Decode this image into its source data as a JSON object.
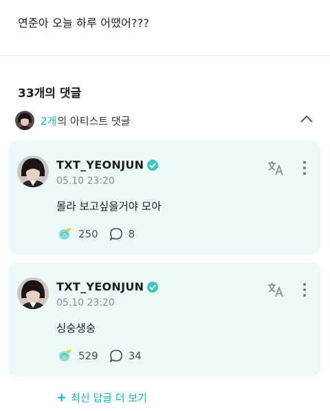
{
  "post": {
    "text": "연준아 오늘 하루 어땠어???"
  },
  "comments_section": {
    "title": "33개의 댓글",
    "artist_toggle": {
      "count": "2개",
      "label": "의 아티스트 댓글",
      "chevron_icon": "chevron-up-icon"
    }
  },
  "comments": [
    {
      "author": "TXT_YEONJUN",
      "verified_icon": "verified-badge-icon",
      "timestamp": "05.10 23:20",
      "text": "몰라 보고싶을거야 모아",
      "cheers": "250",
      "replies": "8"
    },
    {
      "author": "TXT_YEONJUN",
      "verified_icon": "verified-badge-icon",
      "timestamp": "05.10 23:20",
      "text": "싱숭생숭",
      "cheers": "529",
      "replies": "34"
    }
  ],
  "more_replies": {
    "plus": "+",
    "label": "최신 답글 더 보기"
  },
  "colors": {
    "accent": "#13b8b0",
    "card_bg": "#ecfaf7",
    "verified": "#3cc6bf"
  }
}
